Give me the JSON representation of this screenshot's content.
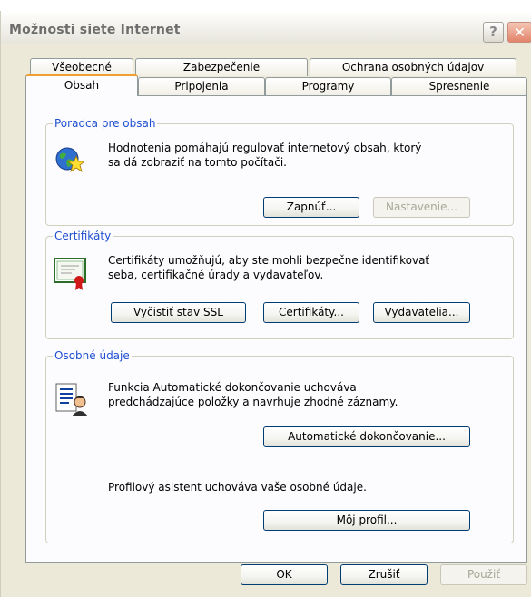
{
  "window": {
    "title": "Možnosti siete Internet",
    "help_label": "?",
    "close_label": "✕"
  },
  "tabs": {
    "row_back": [
      "Všeobecné",
      "Zabezpečenie",
      "Ochrana osobných údajov"
    ],
    "row_front": [
      "Obsah",
      "Pripojenia",
      "Programy",
      "Spresnenie"
    ],
    "active": "Obsah"
  },
  "content_advisor": {
    "title": "Poradca pre obsah",
    "description_line1": "Hodnotenia pomáhajú regulovať internetový obsah, ktorý",
    "description_line2": "sa dá zobraziť na tomto počítači.",
    "enable_button": "Zapnúť...",
    "settings_button": "Nastavenie..."
  },
  "certificates": {
    "title": "Certifikáty",
    "description_line1": "Certifikáty umožňujú, aby ste mohli bezpečne identifikovať",
    "description_line2": "seba, certifikačné úrady a vydavateľov.",
    "clear_ssl_button": "Vyčistiť stav SSL",
    "certificates_button": "Certifikáty...",
    "publishers_button": "Vydavatelia..."
  },
  "personal": {
    "title": "Osobné údaje",
    "autocomplete_line1": "Funkcia Automatické dokončovanie uchováva",
    "autocomplete_line2": "predchádzajúce položky a navrhuje zhodné záznamy.",
    "autocomplete_button": "Automatické dokončovanie...",
    "profile_text": "Profilový asistent uchováva vaše osobné údaje.",
    "profile_button": "Môj profil..."
  },
  "footer": {
    "ok_button": "OK",
    "cancel_button": "Zrušiť",
    "apply_button": "Použiť"
  }
}
